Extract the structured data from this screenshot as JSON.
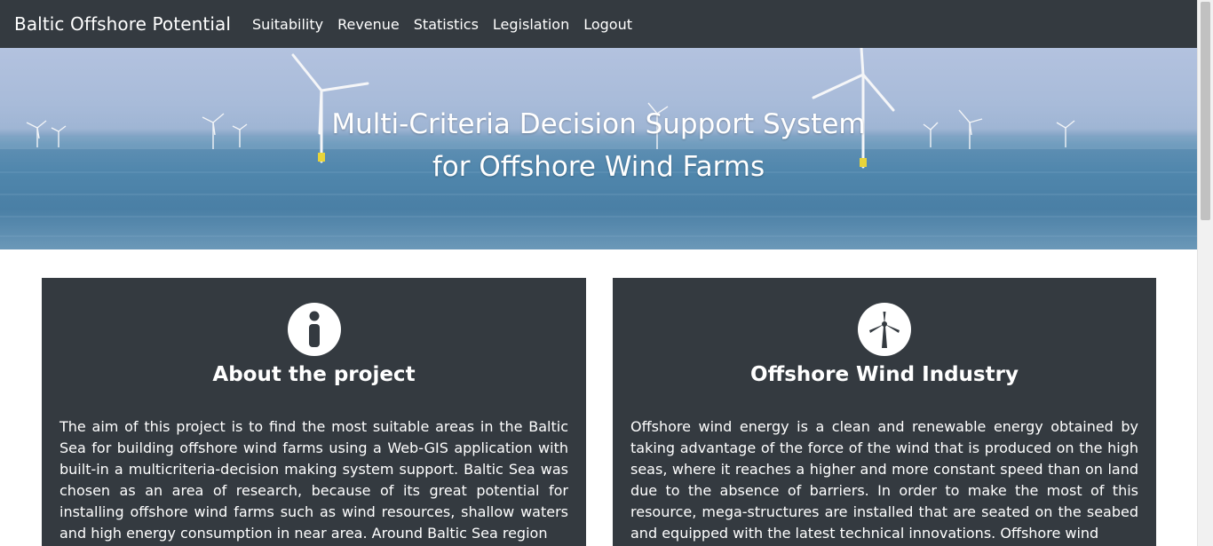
{
  "navbar": {
    "brand": "Baltic Offshore Potential",
    "links": [
      "Suitability",
      "Revenue",
      "Statistics",
      "Legislation",
      "Logout"
    ]
  },
  "hero": {
    "title_line1": "Multi-Criteria Decision Support System",
    "title_line2": "for Offshore Wind Farms"
  },
  "cards": [
    {
      "icon": "info-icon",
      "title": "About the project",
      "text": "The aim of this project is to find the most suitable areas in the Baltic Sea for building offshore wind farms using a Web-GIS application with built-in a multicriteria-decision making system support. Baltic Sea was chosen as an area of research, because of its great potential for installing offshore wind farms such as wind resources, shallow waters and high energy consumption in near area. Around Baltic Sea region"
    },
    {
      "icon": "wind-turbine-icon",
      "title": "Offshore Wind Industry",
      "text": "Offshore wind energy is a clean and renewable energy obtained by taking advantage of the force of the wind that is produced on the high seas, where it reaches a higher and more constant speed than on land due to the absence of barriers. In order to make the most of this resource, mega-structures are installed that are seated on the seabed and equipped with the latest technical innovations. Offshore wind"
    }
  ],
  "colors": {
    "navbar_bg": "#343a40",
    "card_bg": "#343a40",
    "text_light": "#ffffff"
  }
}
